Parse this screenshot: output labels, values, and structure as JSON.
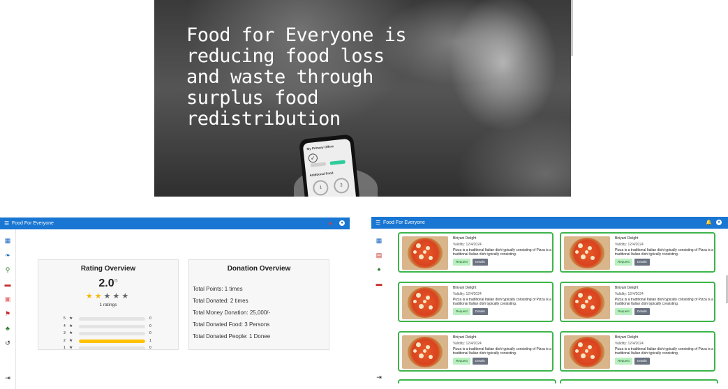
{
  "hero": {
    "title": "Food for Everyone is reducing food loss and waste through surplus food redistribution",
    "phone": {
      "screen_title": "My Primary Offers",
      "section_title": "Additional Food",
      "check_glyph": "✓",
      "ring_1": "1",
      "ring_2": "2"
    }
  },
  "app_title": "Food For Everyone",
  "icons": {
    "menu": "menu-icon",
    "bell": "bell-icon",
    "account": "account-icon",
    "logout": "logout-icon"
  },
  "left_panel": {
    "sidebar_items": [
      {
        "name": "dashboard-icon",
        "glyph": "▦",
        "color": "#1565c0"
      },
      {
        "name": "donate-icon",
        "glyph": "❧",
        "color": "#1565c0"
      },
      {
        "name": "location-icon",
        "glyph": "⚲",
        "color": "#2e7d32"
      },
      {
        "name": "chat-icon",
        "glyph": "▬",
        "color": "#c62828"
      },
      {
        "name": "calendar-icon",
        "glyph": "▣",
        "color": "#e57373"
      },
      {
        "name": "map-pin-icon",
        "glyph": "⚑",
        "color": "#c62828"
      },
      {
        "name": "gift-icon",
        "glyph": "♣",
        "color": "#2e7d32"
      },
      {
        "name": "history-icon",
        "glyph": "↺",
        "color": "#222222"
      }
    ],
    "logout_glyph": "⇥",
    "rating": {
      "title": "Rating Overview",
      "average": "2.0",
      "average_suffix": "/5",
      "stars_filled": 2,
      "stars_total": 5,
      "ratings_label": "1 ratings",
      "distribution": [
        {
          "stars": "5",
          "count": "0",
          "fraction": 0
        },
        {
          "stars": "4",
          "count": "0",
          "fraction": 0
        },
        {
          "stars": "3",
          "count": "0",
          "fraction": 0
        },
        {
          "stars": "2",
          "count": "1",
          "fraction": 1
        },
        {
          "stars": "1",
          "count": "0",
          "fraction": 0
        }
      ]
    },
    "donation": {
      "title": "Donation Overview",
      "lines": [
        "Total Points: 1 times",
        "Total Donated: 2 times",
        "Total Money Donation: 25,000/-",
        "Total Donated Food: 3 Persons",
        "Total Donated People: 1 Donee"
      ]
    },
    "colors": {
      "appbar": "#1976d2",
      "notification_dot": "#e53935",
      "star": "#f5b800",
      "bar": "#ffc107"
    }
  },
  "right_panel": {
    "sidebar_items": [
      {
        "name": "dashboard-icon",
        "glyph": "▦",
        "color": "#1565c0"
      },
      {
        "name": "food-box-icon",
        "glyph": "▤",
        "color": "#c62828"
      },
      {
        "name": "plant-icon",
        "glyph": "♠",
        "color": "#2e7d32"
      },
      {
        "name": "chat-icon",
        "glyph": "▬",
        "color": "#c62828"
      }
    ],
    "logout_glyph": "⇥",
    "food_cards": [
      {
        "name": "Biriyani Delight",
        "validity": "Validity: 12/4/2024",
        "description": "Pizza is a traditional Italian dish typically consisting of Pizza is a traditional Italian dish typically consisting.",
        "request_label": "Request",
        "details_label": "Details"
      },
      {
        "name": "Biriyani Delight",
        "validity": "Validity: 12/4/2024",
        "description": "Pizza is a traditional Italian dish typically consisting of Pizza is a traditional Italian dish typically consisting.",
        "request_label": "Request",
        "details_label": "Details"
      },
      {
        "name": "Biriyani Delight",
        "validity": "Validity: 12/4/2024",
        "description": "Pizza is a traditional Italian dish typically consisting of Pizza is a traditional Italian dish typically consisting.",
        "request_label": "Request",
        "details_label": "Details"
      },
      {
        "name": "Biriyani Delight",
        "validity": "Validity: 12/4/2024",
        "description": "Pizza is a traditional Italian dish typically consisting of Pizza is a traditional Italian dish typically consisting.",
        "request_label": "Request",
        "details_label": "Details"
      },
      {
        "name": "Biriyani Delight",
        "validity": "Validity: 12/4/2024",
        "description": "Pizza is a traditional Italian dish typically consisting of Pizza is a traditional Italian dish typically consisting.",
        "request_label": "Request",
        "details_label": "Details"
      },
      {
        "name": "Biriyani Delight",
        "validity": "Validity: 12/4/2024",
        "description": "Pizza is a traditional Italian dish typically consisting of Pizza is a traditional Italian dish typically consisting.",
        "request_label": "Request",
        "details_label": "Details"
      }
    ],
    "colors": {
      "card_border": "#3cb54a",
      "request_bg": "#b9f0c0",
      "details_bg": "#6b7280"
    }
  }
}
